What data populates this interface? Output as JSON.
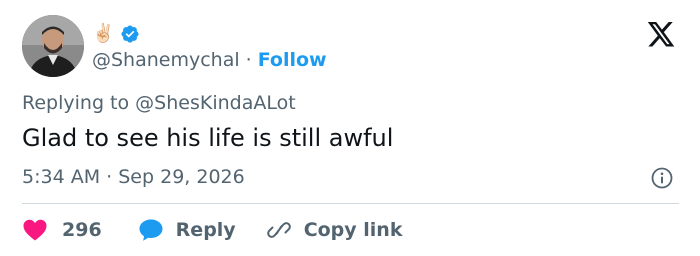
{
  "author": {
    "emoji": "✌🏻",
    "handle": "@Shanemychal",
    "follow_label": "Follow",
    "separator": "·",
    "verified": true
  },
  "reply_context": {
    "prefix": "Replying to",
    "mention": "@ShesKindaALot"
  },
  "tweet": {
    "text": "Glad to see his life is still awful",
    "time": "5:34 AM",
    "separator": "·",
    "date": "Sep 29, 2026"
  },
  "actions": {
    "like_count": "296",
    "reply_label": "Reply",
    "copy_link_label": "Copy link"
  },
  "icons": {
    "brand": "x-logo-icon",
    "verified": "verified-badge-icon",
    "info": "info-icon",
    "like": "heart-icon",
    "reply": "speech-bubble-icon",
    "copy_link": "link-icon"
  },
  "colors": {
    "accent": "#1d9bf0",
    "like": "#f91880",
    "secondary_text": "#536471",
    "primary_text": "#0f1419",
    "divider": "#cfd9de"
  }
}
